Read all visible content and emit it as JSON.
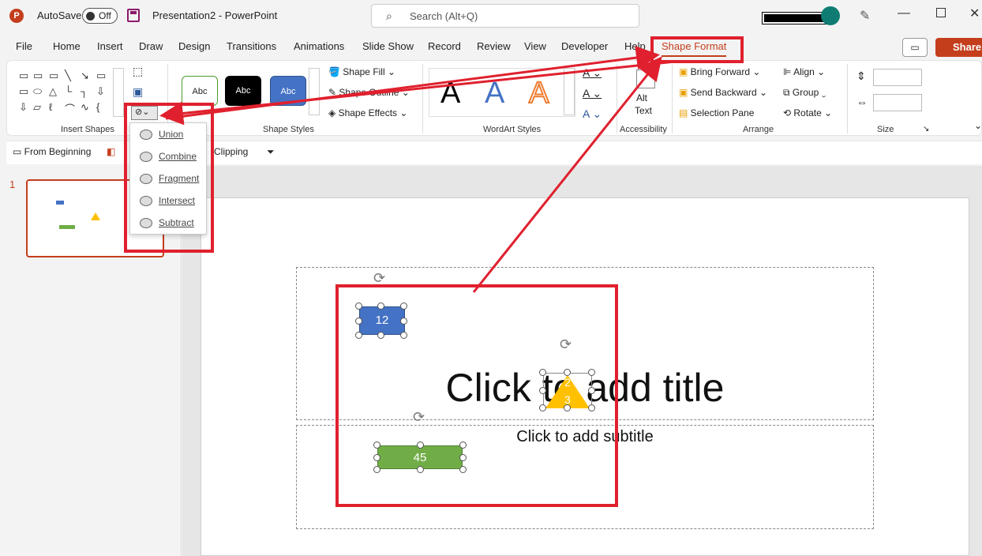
{
  "title_bar": {
    "app_logo": "P",
    "autosave_label": "AutoSave",
    "autosave_state": "Off",
    "document_title": "Presentation2  -  PowerPoint",
    "search_placeholder": "Search (Alt+Q)"
  },
  "tabs": [
    "File",
    "Home",
    "Insert",
    "Draw",
    "Design",
    "Transitions",
    "Animations",
    "Slide Show",
    "Record",
    "Review",
    "View",
    "Developer",
    "Help",
    "Shape Format"
  ],
  "active_tab": "Shape Format",
  "share_label": "Share",
  "ribbon": {
    "groups": {
      "insert_shapes": "Insert Shapes",
      "shape_styles": "Shape Styles",
      "wordart_styles": "WordArt Styles",
      "accessibility": "Accessibility",
      "arrange": "Arrange",
      "size": "Size"
    },
    "shape_fill": "Shape Fill",
    "shape_outline": "Shape Outline",
    "shape_effects": "Shape Effects",
    "style_sample": "Abc",
    "wordart_sample": "A",
    "alt_text": [
      "Alt",
      "Text"
    ],
    "bring_forward": "Bring Forward",
    "send_backward": "Send Backward",
    "selection_pane": "Selection Pane",
    "align": "Align",
    "group": "Group",
    "rotate": "Rotate"
  },
  "quick_access": {
    "from_beginning": "From Beginning",
    "clipping": "Clipping"
  },
  "merge_menu": {
    "items": [
      "Union",
      "Combine",
      "Fragment",
      "Intersect",
      "Subtract"
    ]
  },
  "slide_panel": {
    "slide_number": "1"
  },
  "slide": {
    "title_placeholder": "Click to add title",
    "subtitle_placeholder": "Click to add subtitle",
    "shapes": {
      "blue_rect_label": "12",
      "triangle_label_top": "2",
      "triangle_label_bottom": "3",
      "green_rect_label": "45"
    }
  },
  "colors": {
    "accent": "#c43e1c",
    "annotation_red": "#e0202e",
    "blue_shape": "#4472c4",
    "green_shape": "#70ad47",
    "yellow_shape": "#ffc000"
  }
}
